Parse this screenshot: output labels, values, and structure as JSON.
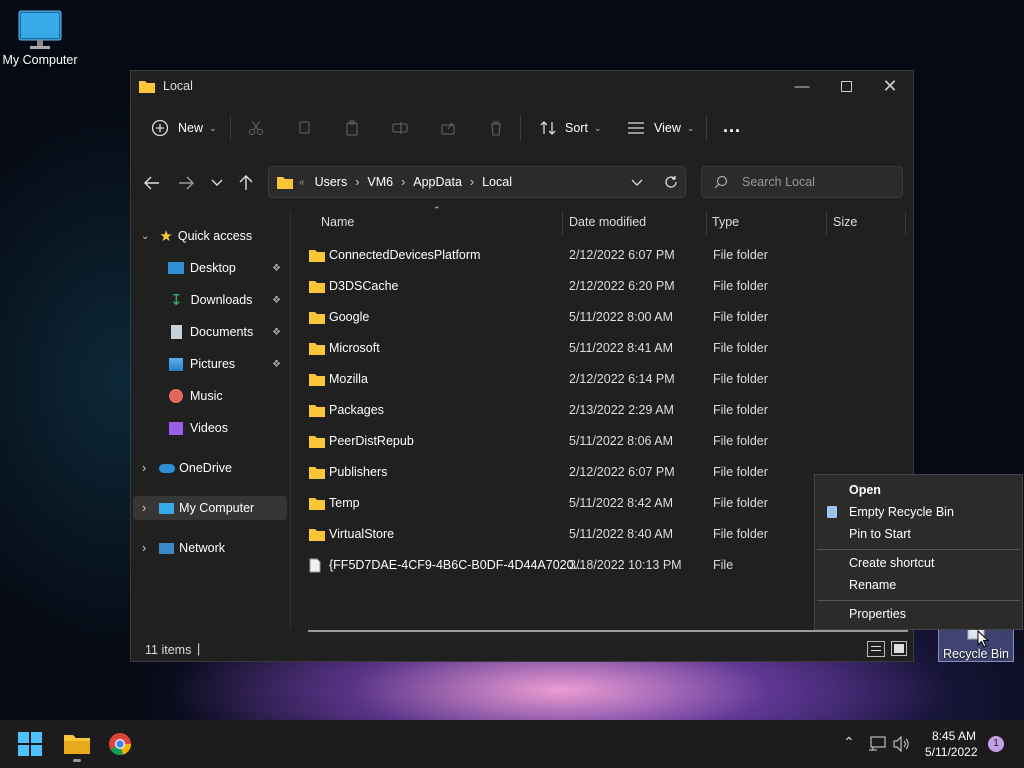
{
  "desktop": {
    "my_computer_label": "My Computer",
    "recycle_bin_label": "Recycle Bin"
  },
  "window": {
    "title": "Local",
    "commands": {
      "new_label": "New",
      "sort_label": "Sort",
      "view_label": "View",
      "more_label": "..."
    },
    "address": {
      "overflow": "«",
      "crumbs": [
        "Users",
        "VM6",
        "AppData",
        "Local"
      ]
    },
    "search": {
      "placeholder": "Search Local"
    },
    "sidebar": {
      "quick_access": "Quick access",
      "items": [
        "Desktop",
        "Downloads",
        "Documents",
        "Pictures",
        "Music",
        "Videos"
      ],
      "onedrive": "OneDrive",
      "my_computer": "My Computer",
      "network": "Network"
    },
    "columns": {
      "name": "Name",
      "date": "Date modified",
      "type": "Type",
      "size": "Size"
    },
    "files": [
      {
        "name": "ConnectedDevicesPlatform",
        "date": "2/12/2022 6:07 PM",
        "type": "File folder"
      },
      {
        "name": "D3DSCache",
        "date": "2/12/2022 6:20 PM",
        "type": "File folder"
      },
      {
        "name": "Google",
        "date": "5/11/2022 8:00 AM",
        "type": "File folder"
      },
      {
        "name": "Microsoft",
        "date": "5/11/2022 8:41 AM",
        "type": "File folder"
      },
      {
        "name": "Mozilla",
        "date": "2/12/2022 6:14 PM",
        "type": "File folder"
      },
      {
        "name": "Packages",
        "date": "2/13/2022 2:29 AM",
        "type": "File folder"
      },
      {
        "name": "PeerDistRepub",
        "date": "5/11/2022 8:06 AM",
        "type": "File folder"
      },
      {
        "name": "Publishers",
        "date": "2/12/2022 6:07 PM",
        "type": "File folder"
      },
      {
        "name": "Temp",
        "date": "5/11/2022 8:42 AM",
        "type": "File folder"
      },
      {
        "name": "VirtualStore",
        "date": "5/11/2022 8:40 AM",
        "type": "File folder"
      },
      {
        "name": "{FF5D7DAE-4CF9-4B6C-B0DF-4D44A7020...",
        "date": "3/18/2022 10:13 PM",
        "type": "File"
      }
    ],
    "status": {
      "items": "11 items",
      "cursor": "|"
    }
  },
  "context_menu": {
    "open": "Open",
    "empty": "Empty Recycle Bin",
    "pin": "Pin to Start",
    "shortcut": "Create shortcut",
    "rename": "Rename",
    "properties": "Properties"
  },
  "taskbar": {
    "time": "8:45 AM",
    "date": "5/11/2022",
    "notifications": "1"
  },
  "colors": {
    "accent": "#0078d4",
    "folder": "#f8c636",
    "window_bg": "#202020"
  }
}
